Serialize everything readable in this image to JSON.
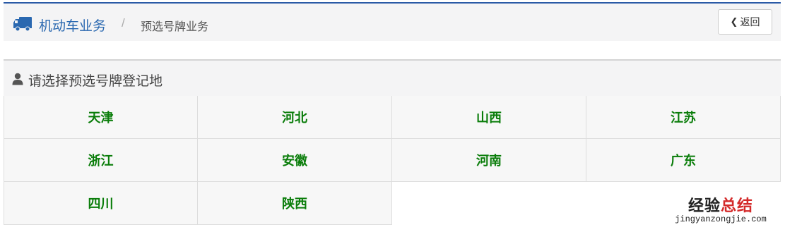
{
  "header": {
    "breadcrumb_home": "机动车业务",
    "breadcrumb_separator": "/",
    "breadcrumb_current": "预选号牌业务",
    "back_label": "返回"
  },
  "panel": {
    "title": "请选择预选号牌登记地"
  },
  "regions": [
    "天津",
    "河北",
    "山西",
    "江苏",
    "浙江",
    "安徽",
    "河南",
    "广东",
    "四川",
    "陕西"
  ],
  "watermark": {
    "title_part1": "经验",
    "title_part2": "总结",
    "url": "jingyanzongjie.com"
  },
  "colors": {
    "accent_blue": "#2a68b0",
    "region_green": "#0a7d0a",
    "watermark_red": "#d42a2a"
  },
  "icons": [
    "truck-icon",
    "chevron-left-icon",
    "user-icon"
  ]
}
